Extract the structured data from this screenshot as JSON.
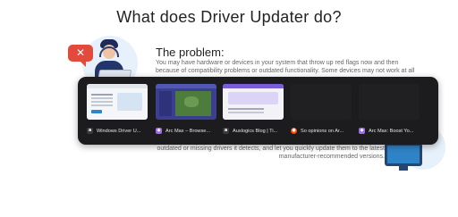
{
  "page": {
    "title": "What does Driver Updater do?",
    "problem_heading": "The problem:",
    "problem_lines": [
      "You may have hardware or devices in your system that throw up red flags now and then",
      "because of compatibility problems or outdated functionality. Some devices may not work at all"
    ],
    "bottom_lines": [
      "outdated or missing drivers it detects, and let you quickly update them to the latest",
      "manufacturer-recommended versions."
    ]
  },
  "switcher": {
    "tabs": [
      {
        "title": "Windows Driver U...",
        "favicon": "a",
        "favicon_color": "#3a3a3a"
      },
      {
        "title": "Arc Max – Browse...",
        "favicon": "arc-icon",
        "favicon_color": "#9b6cf0"
      },
      {
        "title": "Auslogics Blog | Ti...",
        "favicon": "a",
        "favicon_color": "#3a3a3a"
      },
      {
        "title": "So opinions on Ar...",
        "favicon": "reddit-icon",
        "favicon_color": "#ff4500"
      },
      {
        "title": "Arc Max: Boost Yo...",
        "favicon": "arc-icon",
        "favicon_color": "#9b6cf0"
      }
    ]
  },
  "colors": {
    "accent_blue": "#2f84c8",
    "alert_red": "#e24a3b",
    "switcher_bg": "#1c1c1f"
  }
}
